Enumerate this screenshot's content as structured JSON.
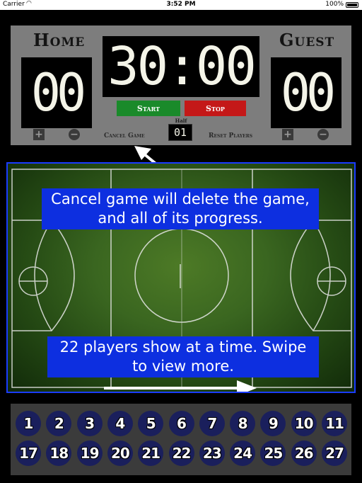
{
  "status_bar": {
    "carrier": "Carrier",
    "time": "3:52 PM",
    "battery": "100%"
  },
  "scoreboard": {
    "home_label": "Home",
    "guest_label": "Guest",
    "home_score": "00",
    "guest_score": "00",
    "clock": "30:00",
    "start_label": "Start",
    "stop_label": "Stop",
    "plus_symbol": "+",
    "minus_symbol": "−",
    "cancel_game_label": "Cancel Game",
    "reset_players_label": "Reset Players",
    "half_label": "Half",
    "half_value": "01"
  },
  "tutorial": {
    "callout_1": "Cancel game will delete the game, and all of its progress.",
    "callout_2": "22 players show at a time. Swipe to view more."
  },
  "players": {
    "row_1": [
      "1",
      "2",
      "3",
      "4",
      "5",
      "6",
      "7",
      "8",
      "9",
      "10",
      "11"
    ],
    "row_2": [
      "17",
      "18",
      "19",
      "20",
      "21",
      "22",
      "23",
      "24",
      "25",
      "26",
      "27"
    ]
  },
  "colors": {
    "accent": "#0d2fe0",
    "start": "#1a8a2a",
    "stop": "#c41818",
    "player_chip": "#1a1f5c"
  }
}
